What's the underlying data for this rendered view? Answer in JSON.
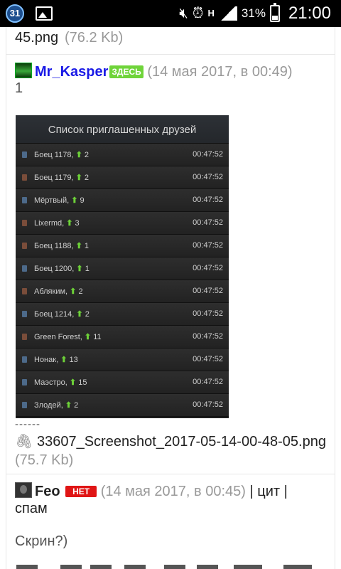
{
  "status_bar": {
    "calendar_day": "31",
    "battery_percent": "31%",
    "time": "21:00",
    "network_type": "H"
  },
  "top_attachment": {
    "filename_tail": "45.png",
    "size": "(76.2 Kb)"
  },
  "post1": {
    "author": "Mr_Kasper",
    "presence_badge": "ЗДЕСЬ",
    "date": "(14 мая 2017, в 00:49)",
    "body": "1"
  },
  "friends_screenshot": {
    "title": "Список приглашенных друзей",
    "rows": [
      {
        "name": "Боец 1178,",
        "count": "2",
        "time": "00:47:52",
        "mark": "blue"
      },
      {
        "name": "Боец 1179,",
        "count": "2",
        "time": "00:47:52",
        "mark": "brown"
      },
      {
        "name": "Мёртвый,",
        "count": "9",
        "time": "00:47:52",
        "mark": "blue"
      },
      {
        "name": "Lixermd,",
        "count": "3",
        "time": "00:47:52",
        "mark": "brown"
      },
      {
        "name": "Боец 1188,",
        "count": "1",
        "time": "00:47:52",
        "mark": "brown"
      },
      {
        "name": "Боец 1200,",
        "count": "1",
        "time": "00:47:52",
        "mark": "blue"
      },
      {
        "name": "Абляким,",
        "count": "2",
        "time": "00:47:52",
        "mark": "brown"
      },
      {
        "name": "Боец 1214,",
        "count": "2",
        "time": "00:47:52",
        "mark": "blue"
      },
      {
        "name": "Green Forest,",
        "count": "11",
        "time": "00:47:52",
        "mark": "brown"
      },
      {
        "name": "Нонак,",
        "count": "13",
        "time": "00:47:52",
        "mark": "blue"
      },
      {
        "name": "Маэстро,",
        "count": "15",
        "time": "00:47:52",
        "mark": "blue"
      },
      {
        "name": "Злодей,",
        "count": "2",
        "time": "00:47:52",
        "mark": "blue"
      }
    ]
  },
  "divider_dashes": "------",
  "attachment": {
    "filename": "33607_Screenshot_2017-05-14-00-48-05.png",
    "size": "(75.7 Kb)"
  },
  "post2": {
    "author": "Feo",
    "presence_badge": "НЕТ",
    "date": "(14 мая 2017, в 00:45)",
    "quote_link": "цит",
    "spam_link": "спам",
    "body": "Скрин?)"
  },
  "colors": {
    "nick_blue": "#1a1ae6",
    "badge_online": "#6fd43a",
    "badge_offline": "#e01515",
    "muted_text": "#999999"
  }
}
